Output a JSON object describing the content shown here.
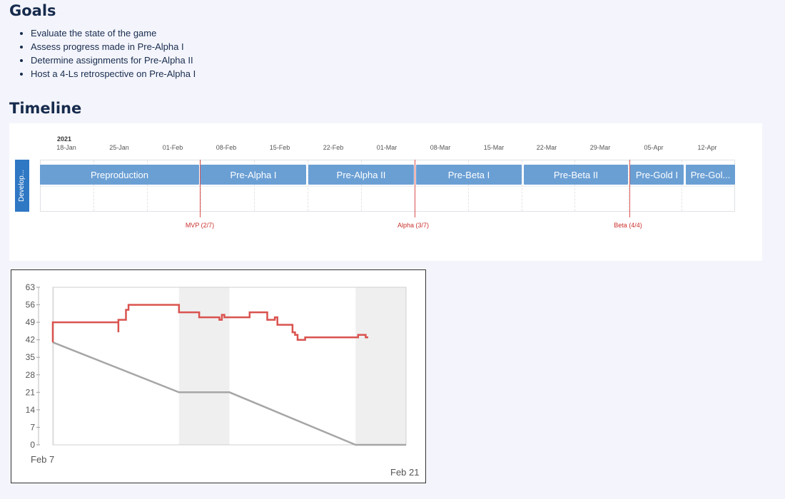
{
  "goals": {
    "title": "Goals",
    "items": [
      "Evaluate the state of the game",
      "Assess progress made in Pre-Alpha I",
      "Determine assignments for Pre-Alpha II",
      "Host a 4-Ls retrospective on Pre-Alpha I"
    ]
  },
  "timeline": {
    "title": "Timeline",
    "year": "2021",
    "dates": [
      "18-Jan",
      "25-Jan",
      "01-Feb",
      "08-Feb",
      "15-Feb",
      "22-Feb",
      "01-Mar",
      "08-Mar",
      "15-Mar",
      "22-Mar",
      "29-Mar",
      "05-Apr",
      "12-Apr"
    ],
    "swimlane": "Develop...",
    "bars": [
      {
        "label": "Preproduction"
      },
      {
        "label": "Pre-Alpha I"
      },
      {
        "label": "Pre-Alpha II"
      },
      {
        "label": "Pre-Beta I"
      },
      {
        "label": "Pre-Beta II"
      },
      {
        "label": "Pre-Gold I"
      },
      {
        "label": "Pre-Gol..."
      }
    ],
    "milestones": [
      {
        "label": "MVP (2/7)"
      },
      {
        "label": "Alpha (3/7)"
      },
      {
        "label": "Beta (4/4)"
      }
    ],
    "colors": {
      "bar": "#6a9fd4",
      "milestone": "#d9534f",
      "swimlane": "#2f78c4"
    }
  },
  "chart_data": {
    "type": "line",
    "title": "",
    "xlabel": "",
    "ylabel": "",
    "x_start_label": "Feb 7",
    "x_end_label": "Feb 21",
    "x_range": [
      "Feb 7",
      "Feb 21"
    ],
    "ylim": [
      0,
      63
    ],
    "yticks": [
      0,
      7,
      14,
      21,
      28,
      35,
      42,
      49,
      56,
      63
    ],
    "weekend_shading": [
      [
        "Feb 12",
        "Feb 14"
      ],
      [
        "Feb 19",
        "Feb 21"
      ]
    ],
    "series": [
      {
        "color": "#d9534f",
        "step": true,
        "points": [
          [
            "Feb 7",
            41
          ],
          [
            "Feb 7",
            41
          ],
          [
            "Feb 7",
            49
          ],
          [
            "Feb 9.6",
            49
          ],
          [
            "Feb 9.6",
            45
          ],
          [
            "Feb 9.6",
            50
          ],
          [
            "Feb 9.9",
            50
          ],
          [
            "Feb 9.9",
            54
          ],
          [
            "Feb 10",
            54
          ],
          [
            "Feb 10",
            56
          ],
          [
            "Feb 12",
            56
          ],
          [
            "Feb 12",
            53
          ],
          [
            "Feb 12.8",
            53
          ],
          [
            "Feb 12.8",
            51
          ],
          [
            "Feb 13.6",
            51
          ],
          [
            "Feb 13.6",
            50
          ],
          [
            "Feb 13.7",
            50
          ],
          [
            "Feb 13.7",
            52
          ],
          [
            "Feb 13.8",
            52
          ],
          [
            "Feb 13.8",
            51
          ],
          [
            "Feb 14.8",
            51
          ],
          [
            "Feb 14.8",
            53
          ],
          [
            "Feb 15.5",
            53
          ],
          [
            "Feb 15.5",
            50
          ],
          [
            "Feb 15.8",
            50
          ],
          [
            "Feb 15.8",
            51
          ],
          [
            "Feb 15.9",
            51
          ],
          [
            "Feb 15.9",
            48
          ],
          [
            "Feb 16.5",
            48
          ],
          [
            "Feb 16.5",
            45
          ],
          [
            "Feb 16.6",
            45
          ],
          [
            "Feb 16.6",
            44
          ],
          [
            "Feb 16.7",
            44
          ],
          [
            "Feb 16.7",
            42
          ],
          [
            "Feb 17",
            42
          ],
          [
            "Feb 17",
            43
          ],
          [
            "Feb 19.1",
            43
          ],
          [
            "Feb 19.1",
            44
          ],
          [
            "Feb 19.4",
            44
          ],
          [
            "Feb 19.4",
            43
          ],
          [
            "Feb 19.5",
            43
          ]
        ]
      },
      {
        "color": "#a6a6a6",
        "step": false,
        "points": [
          [
            "Feb 7",
            41
          ],
          [
            "Feb 12",
            21
          ],
          [
            "Feb 14",
            21
          ],
          [
            "Feb 19",
            0
          ],
          [
            "Feb 21",
            0
          ]
        ]
      }
    ]
  }
}
